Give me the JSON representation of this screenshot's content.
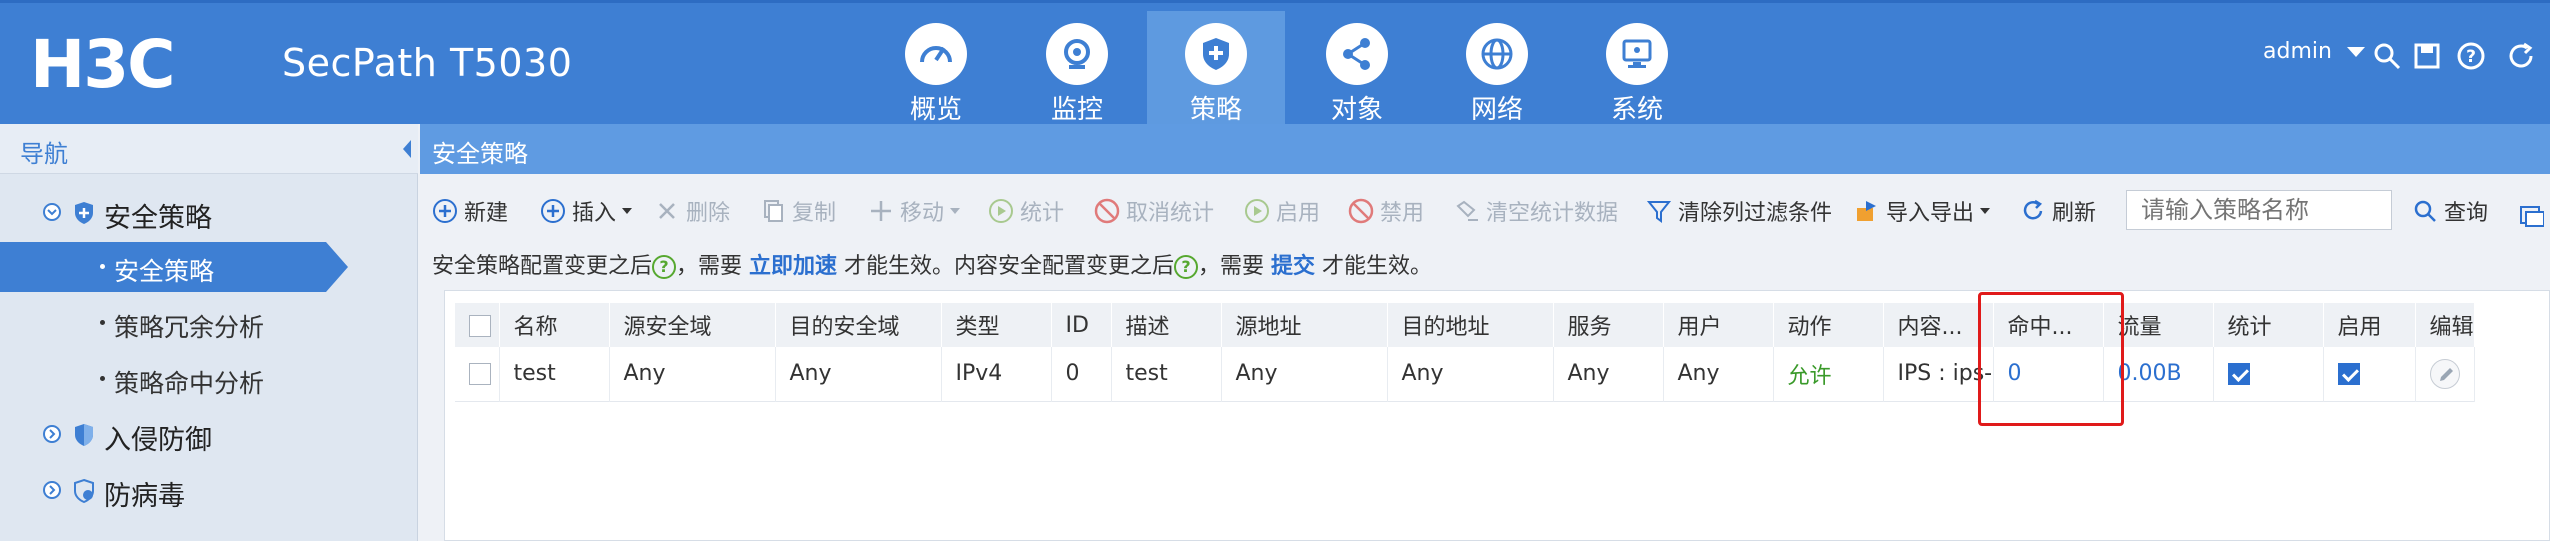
{
  "header": {
    "brand": "H3C",
    "product": "SecPath T5030",
    "user": "admin",
    "tabs": [
      {
        "label": "概览",
        "icon": "gauge-icon"
      },
      {
        "label": "监控",
        "icon": "camera-icon"
      },
      {
        "label": "策略",
        "icon": "shield-icon"
      },
      {
        "label": "对象",
        "icon": "share-icon"
      },
      {
        "label": "网络",
        "icon": "globe-icon"
      },
      {
        "label": "系统",
        "icon": "monitor-icon"
      }
    ],
    "active_tab": "策略",
    "right_icons": [
      "search-icon",
      "save-icon",
      "help-icon",
      "refresh-icon"
    ]
  },
  "sidebar": {
    "title": "导航",
    "groups": [
      {
        "label": "安全策略",
        "children": [
          "安全策略",
          "策略冗余分析",
          "策略命中分析"
        ],
        "active_child": "安全策略"
      },
      {
        "label": "入侵防御"
      },
      {
        "label": "防病毒"
      }
    ]
  },
  "breadcrumb": "安全策略",
  "toolbar": {
    "new": "新建",
    "insert": "插入",
    "delete": "删除",
    "copy": "复制",
    "move": "移动",
    "stats": "统计",
    "cancel_stats": "取消统计",
    "enable": "启用",
    "disable": "禁用",
    "clear_stats": "清空统计数据",
    "clear_filter": "清除列过滤条件",
    "import_export": "导入导出",
    "refresh": "刷新",
    "search_placeholder": "请输入策略名称",
    "query": "查询"
  },
  "notice": {
    "part1": "安全策略配置变更之后",
    "part2": "，需要 ",
    "link1": "立即加速",
    "part3": " 才能生效。内容安全配置变更之后",
    "part4": "，需要 ",
    "link2": "提交",
    "part5": " 才能生效。"
  },
  "table": {
    "columns": [
      "名称",
      "源安全域",
      "目的安全域",
      "类型",
      "ID",
      "描述",
      "源地址",
      "目的地址",
      "服务",
      "用户",
      "动作",
      "内容...",
      "命中...",
      "流量",
      "统计",
      "启用",
      "编辑"
    ],
    "rows": [
      {
        "name": "test",
        "src_zone": "Any",
        "dst_zone": "Any",
        "type": "IPv4",
        "id": "0",
        "desc": "test",
        "src_addr": "Any",
        "dst_addr": "Any",
        "service": "Any",
        "user": "Any",
        "action": "允许",
        "content": "IPS : ips-",
        "hits": "0",
        "traffic": "0.00B",
        "stats_checked": true,
        "enabled_checked": true
      }
    ]
  },
  "colors": {
    "topbar": "#3e7fd3",
    "active_tab": "#5e9ae0",
    "highlight": "#e01a1a",
    "link": "#2b6fcf",
    "allow": "#3a9a2a"
  }
}
